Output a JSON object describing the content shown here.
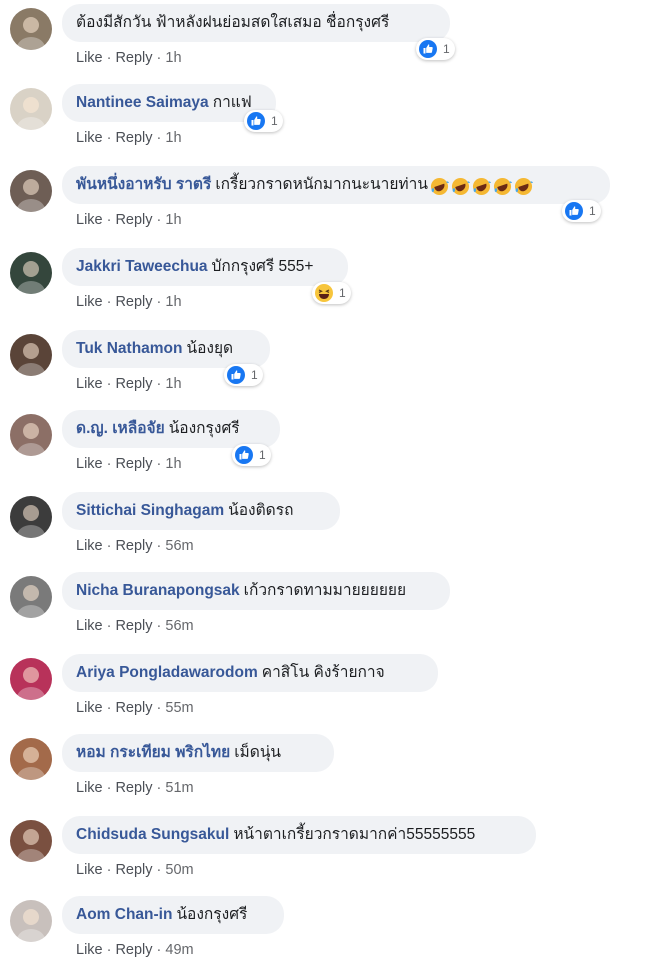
{
  "actions": {
    "like": "Like",
    "reply": "Reply",
    "sep": "·"
  },
  "comments": [
    {
      "author": "",
      "text": "ต้องมีสักวัน ฟ้าหลังฝนย่อมสดใสเสมอ ชื่อกรุงศรี",
      "time": "1h",
      "reaction": "like",
      "reaction_count": "1",
      "avatar_color": "#8a7a66"
    },
    {
      "author": "Nantinee Saimaya",
      "text": "กาแฟ",
      "time": "1h",
      "reaction": "like",
      "reaction_count": "1",
      "avatar_color": "#d9d2c6"
    },
    {
      "author": "พันหนึ่งอาหรับ ราตรี",
      "text": "เกรี้ยวกราดหนักมากนะนายท่าน",
      "time": "1h",
      "reaction": "like",
      "reaction_count": "1",
      "avatar_color": "#6e5e55",
      "emojis": [
        "laugh-cry-emoji",
        "laugh-cry-emoji",
        "laugh-cry-emoji",
        "laugh-cry-emoji",
        "laugh-cry-emoji"
      ]
    },
    {
      "author": "Jakkri Taweechua",
      "text": "บักกรุงศรี 555+",
      "time": "1h",
      "reaction": "haha",
      "reaction_count": "1",
      "avatar_color": "#34463c"
    },
    {
      "author": "Tuk Nathamon",
      "text": "น้องยุด",
      "time": "1h",
      "reaction": "like",
      "reaction_count": "1",
      "avatar_color": "#5a4438"
    },
    {
      "author": "ด.ญ. เหลือจัย",
      "text": "น้องกรุงศรี",
      "time": "1h",
      "reaction": "like",
      "reaction_count": "1",
      "avatar_color": "#8c6f66"
    },
    {
      "author": "Sittichai Singhagam",
      "text": "น้องติดรถ",
      "time": "56m",
      "reaction": "",
      "reaction_count": "",
      "avatar_color": "#3c3c3c"
    },
    {
      "author": "Nicha Buranapongsak",
      "text": "เก้วกราดทามมายยยยยย",
      "time": "56m",
      "reaction": "",
      "reaction_count": "",
      "avatar_color": "#7a7a7a"
    },
    {
      "author": "Ariya Pongladawarodom",
      "text": "คาสิโน คิงร้ายกาจ",
      "time": "55m",
      "reaction": "",
      "reaction_count": "",
      "avatar_color": "#b8325a"
    },
    {
      "author": "หอม กระเทียม พริกไทย",
      "text": "เม็ดนุ่น",
      "time": "51m",
      "reaction": "",
      "reaction_count": "",
      "avatar_color": "#a36a4a"
    },
    {
      "author": "Chidsuda Sungsakul",
      "text": "หน้าตาเกรี้ยวกราดมากค่า55555555",
      "time": "50m",
      "reaction": "",
      "reaction_count": "",
      "avatar_color": "#7a5040"
    },
    {
      "author": "Aom Chan-in",
      "text": "น้องกรุงศรี",
      "time": "49m",
      "reaction": "",
      "reaction_count": "",
      "avatar_color": "#c8c0bc"
    }
  ],
  "colors": {
    "like_blue": "#1877f2",
    "haha_yellow": "#f7c53c",
    "author_blue": "#385898",
    "bubble_bg": "#f0f2f5"
  }
}
